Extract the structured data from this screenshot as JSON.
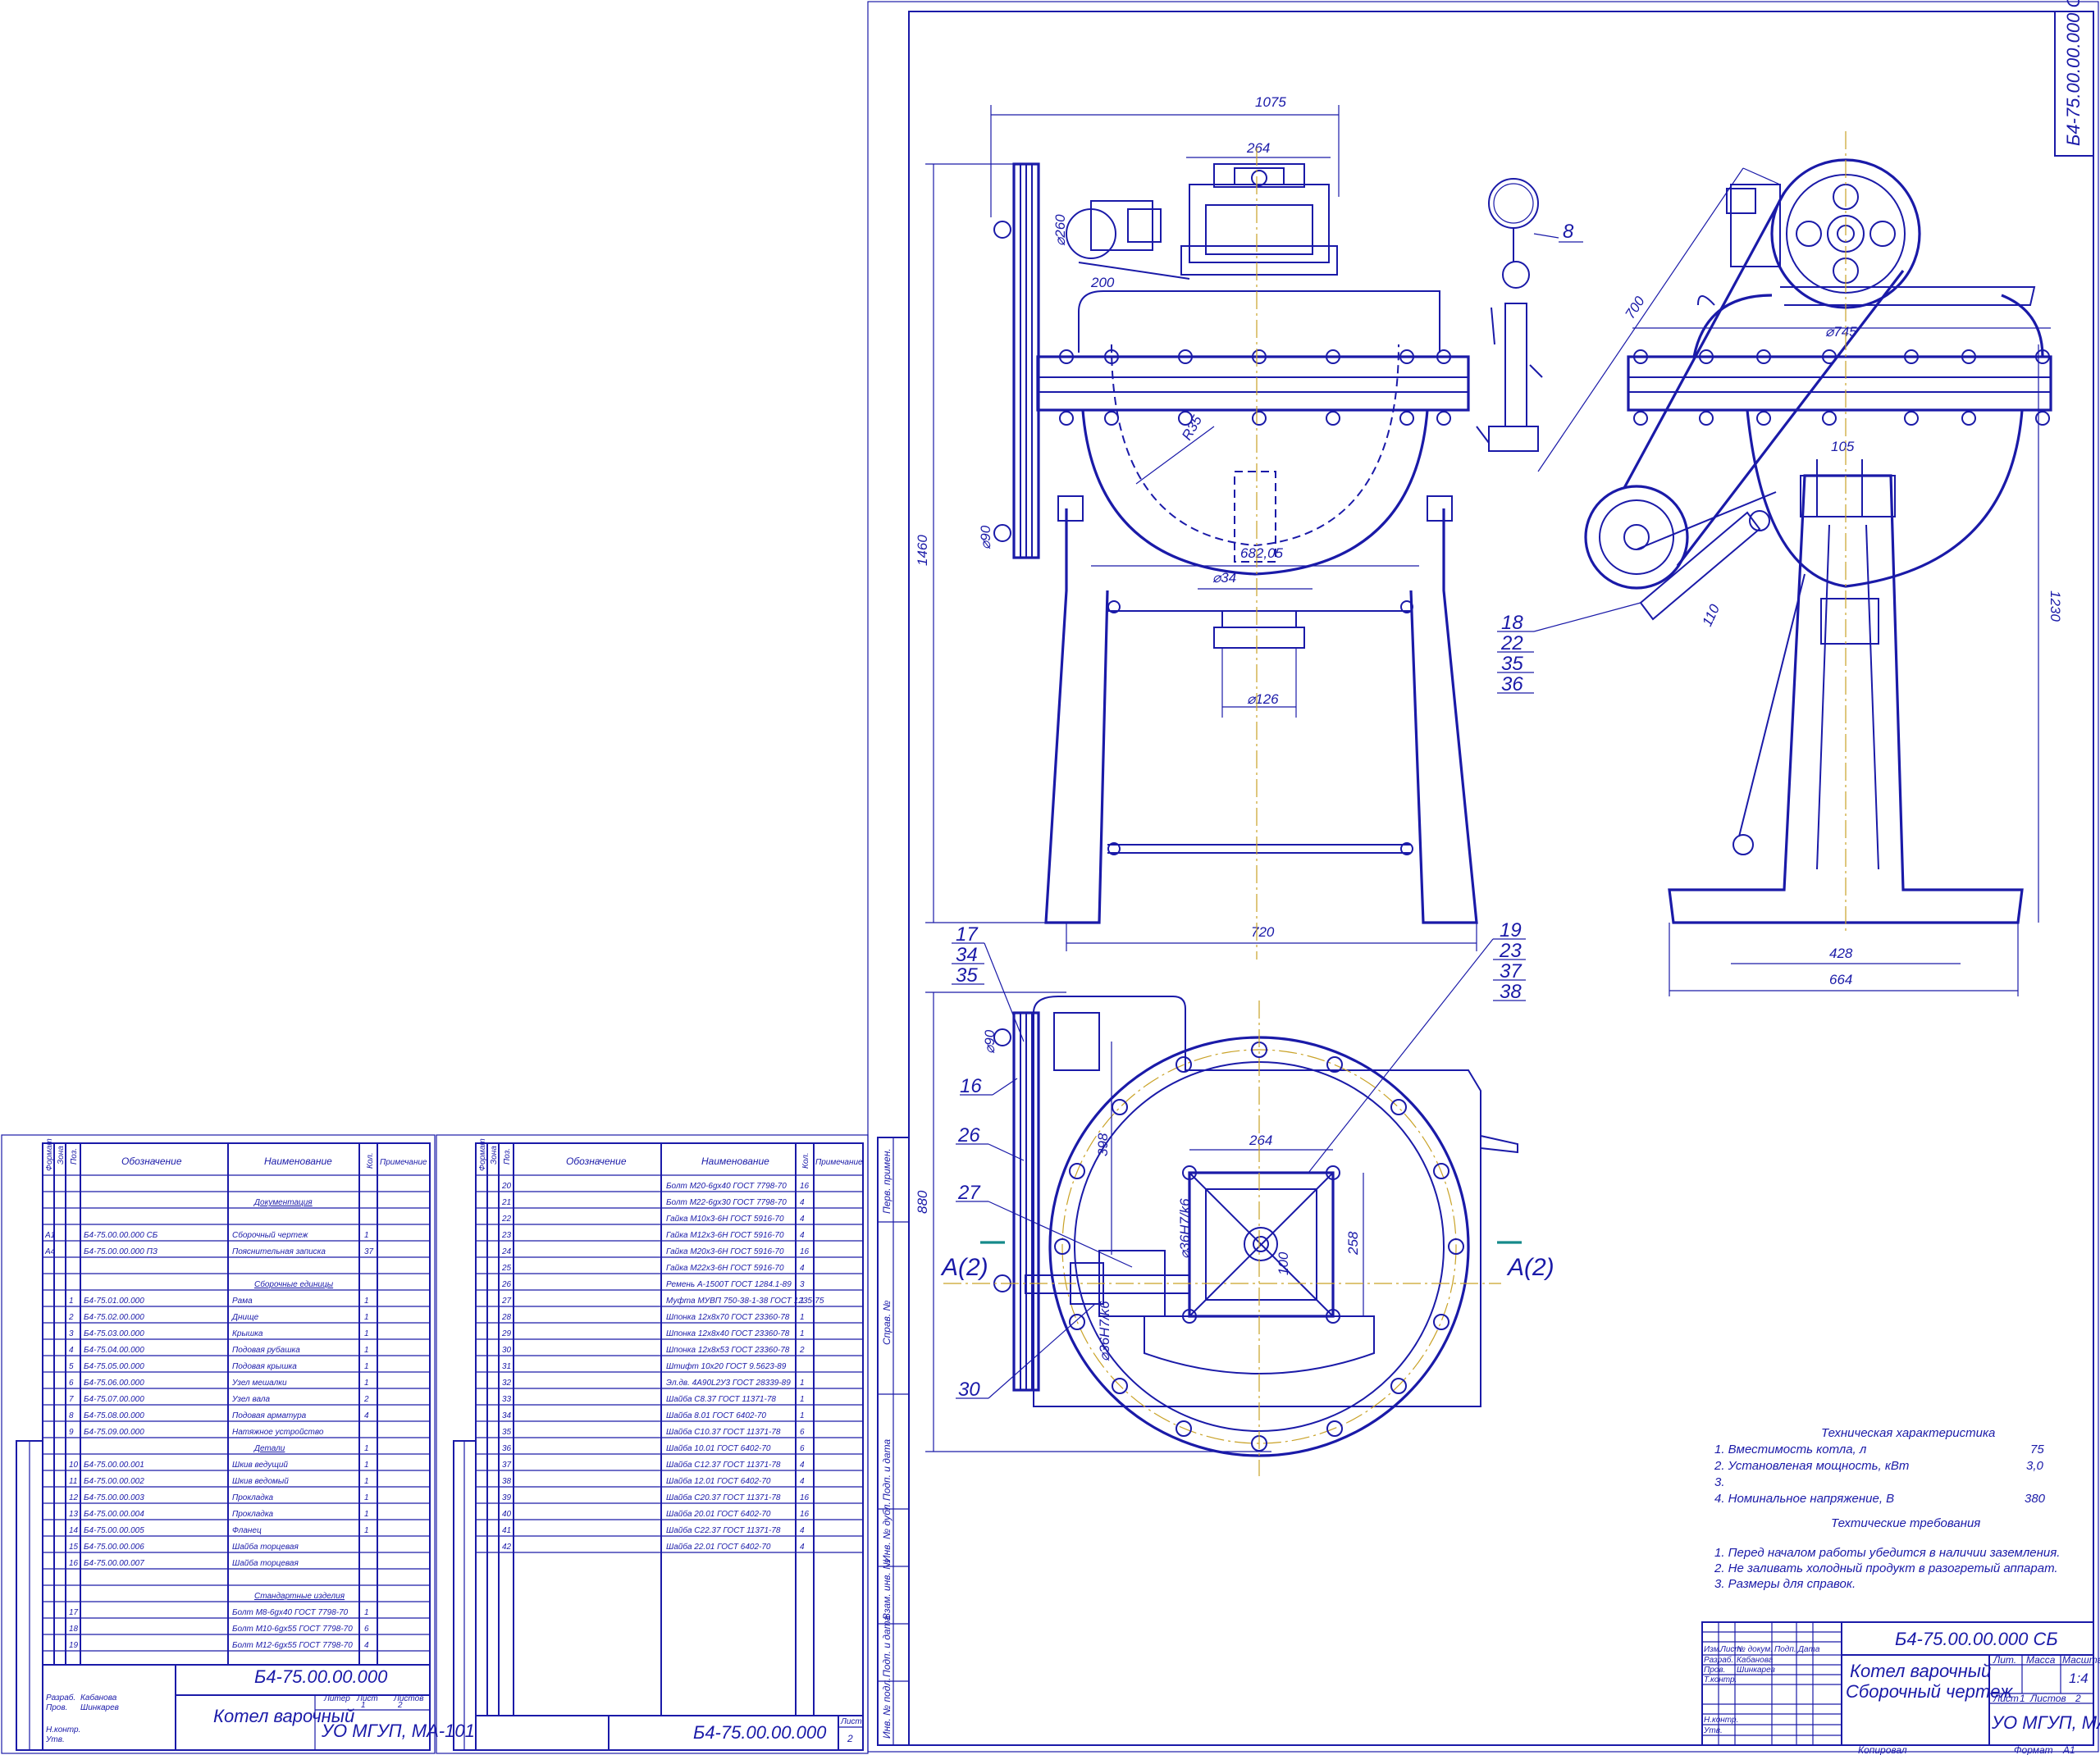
{
  "drawing": {
    "code": "Б4-75.00.00.000 СБ",
    "code_short": "Б4-75.00.00.000",
    "title_line1": "Котел варочный",
    "title_line2": "Сборочный чертеж",
    "org": "УО МГУП, МА-101",
    "mass_scale": "1:4",
    "sheet_label": "Лист",
    "sheet_value": "1",
    "sheets_label": "Листов",
    "sheets_value": "2",
    "lit_label": "Лит.",
    "mass_label": "Масса",
    "scale_label": "Масштаб",
    "copy_label": "Копировал",
    "format_label": "Формат",
    "format_value": "А1",
    "roles": [
      "Изм.",
      "Лист",
      "№ докум.",
      "Подп.",
      "Дата"
    ],
    "people": [
      {
        "role": "Разраб.",
        "name": "Кабанова"
      },
      {
        "role": "Пров.",
        "name": "Шинкарев"
      },
      {
        "role": "Т.контр.",
        "name": ""
      },
      {
        "role": "",
        "name": ""
      },
      {
        "role": "Н.контр.",
        "name": ""
      },
      {
        "role": "Утв.",
        "name": ""
      }
    ]
  },
  "side_stamp": [
    "Перв. примен.",
    "Справ. №",
    "Подп. и дата",
    "Инв. № дубл.",
    "Взам. инв. №",
    "Подп. и дата",
    "Инв. № подл."
  ],
  "dimensions": {
    "d1075": "1075",
    "d264a": "264",
    "d200": "200",
    "d260": "⌀260",
    "d1460": "1460",
    "d90a": "⌀90",
    "dR35": "R35",
    "d68205": "682,05",
    "d34": "⌀34",
    "d126": "⌀126",
    "d720": "720",
    "d700": "700",
    "d745": "⌀745",
    "d105": "105",
    "d110": "110",
    "d1230": "1230",
    "d428": "428",
    "d664": "664",
    "d90b": "⌀90",
    "d398": "398",
    "d264b": "264",
    "d258": "258",
    "d100": "100",
    "d880": "880",
    "fit1": "⌀36H7/k6",
    "fit2": "⌀36H7/k6"
  },
  "callouts": {
    "c8": "8",
    "c18": [
      "18",
      "22",
      "35",
      "36"
    ],
    "c17": [
      "17",
      "34",
      "35"
    ],
    "c19": [
      "19",
      "23",
      "37",
      "38"
    ],
    "c16": "16",
    "c26": "26",
    "c27": "27",
    "c30": "30"
  },
  "section": {
    "left": "А(2)",
    "right": "А(2)"
  },
  "tech": {
    "title": "Техническая характеристика",
    "rows": [
      {
        "text": "1. Вместимость котла, л",
        "value": "75"
      },
      {
        "text": "2. Установленая мощность, кВт",
        "value": "3,0"
      },
      {
        "text": "3.",
        "value": ""
      },
      {
        "text": "4. Номинальное напряжение, В",
        "value": "380"
      }
    ]
  },
  "req": {
    "title": "Техтические требования",
    "rows": [
      "1. Перед началом работы убедится в наличии заземления.",
      "2. Не заливать холодный продукт в разогретый аппарат.",
      "3. Размеры для справок."
    ]
  },
  "spec": {
    "headers": [
      "Формат",
      "Зона",
      "Поз.",
      "Обозначение",
      "Наименование",
      "Кол.",
      "Примечание"
    ],
    "sheet1": [
      {
        "fmt": "",
        "pos": "",
        "des": "",
        "name": "",
        "qty": ""
      },
      {
        "fmt": "",
        "pos": "",
        "des": "",
        "name": "Документация",
        "qty": "",
        "head": true
      },
      {
        "fmt": "",
        "pos": "",
        "des": "",
        "name": "",
        "qty": ""
      },
      {
        "fmt": "А1",
        "pos": "",
        "des": "Б4-75.00.00.000 СБ",
        "name": "Сборочный чертеж",
        "qty": "1"
      },
      {
        "fmt": "А4",
        "pos": "",
        "des": "Б4-75.00.00.000 ПЗ",
        "name": "Пояснительная записка",
        "qty": "37"
      },
      {
        "fmt": "",
        "pos": "",
        "des": "",
        "name": "",
        "qty": ""
      },
      {
        "fmt": "",
        "pos": "",
        "des": "",
        "name": "Сборочные единицы",
        "qty": "",
        "head": true
      },
      {
        "fmt": "",
        "pos": "1",
        "des": "Б4-75.01.00.000",
        "name": "Рама",
        "qty": "1"
      },
      {
        "fmt": "",
        "pos": "2",
        "des": "Б4-75.02.00.000",
        "name": "Днище",
        "qty": "1"
      },
      {
        "fmt": "",
        "pos": "3",
        "des": "Б4-75.03.00.000",
        "name": "Крышка",
        "qty": "1"
      },
      {
        "fmt": "",
        "pos": "4",
        "des": "Б4-75.04.00.000",
        "name": "Подовая рубашка",
        "qty": "1"
      },
      {
        "fmt": "",
        "pos": "5",
        "des": "Б4-75.05.00.000",
        "name": "Подовая крышка",
        "qty": "1"
      },
      {
        "fmt": "",
        "pos": "6",
        "des": "Б4-75.06.00.000",
        "name": "Узел мешалки",
        "qty": "1"
      },
      {
        "fmt": "",
        "pos": "7",
        "des": "Б4-75.07.00.000",
        "name": "Узел вала",
        "qty": "2"
      },
      {
        "fmt": "",
        "pos": "8",
        "des": "Б4-75.08.00.000",
        "name": "Подовая арматура",
        "qty": "4"
      },
      {
        "fmt": "",
        "pos": "9",
        "des": "Б4-75.09.00.000",
        "name": "Натяжное устройство",
        "qty": ""
      },
      {
        "fmt": "",
        "pos": "",
        "des": "",
        "name": "Детали",
        "qty": "1",
        "head": true
      },
      {
        "fmt": "",
        "pos": "10",
        "des": "Б4-75.00.00.001",
        "name": "Шкив ведущий",
        "qty": "1"
      },
      {
        "fmt": "",
        "pos": "11",
        "des": "Б4-75.00.00.002",
        "name": "Шкив ведомый",
        "qty": "1"
      },
      {
        "fmt": "",
        "pos": "12",
        "des": "Б4-75.00.00.003",
        "name": "Прокладка",
        "qty": "1"
      },
      {
        "fmt": "",
        "pos": "13",
        "des": "Б4-75.00.00.004",
        "name": "Прокладка",
        "qty": "1"
      },
      {
        "fmt": "",
        "pos": "14",
        "des": "Б4-75.00.00.005",
        "name": "Фланец",
        "qty": "1"
      },
      {
        "fmt": "",
        "pos": "15",
        "des": "Б4-75.00.00.006",
        "name": "Шайба торцевая",
        "qty": ""
      },
      {
        "fmt": "",
        "pos": "16",
        "des": "Б4-75.00.00.007",
        "name": "Шайба торцевая",
        "qty": ""
      },
      {
        "fmt": "",
        "pos": "",
        "des": "",
        "name": "",
        "qty": ""
      },
      {
        "fmt": "",
        "pos": "",
        "des": "",
        "name": "Стандартные изделия",
        "qty": "",
        "head": true
      },
      {
        "fmt": "",
        "pos": "17",
        "des": "",
        "name": "Болт М8-6gх40 ГОСТ 7798-70",
        "qty": "1"
      },
      {
        "fmt": "",
        "pos": "18",
        "des": "",
        "name": "Болт М10-6gх55 ГОСТ 7798-70",
        "qty": "6"
      },
      {
        "fmt": "",
        "pos": "19",
        "des": "",
        "name": "Болт М12-6gх55 ГОСТ 7798-70",
        "qty": "4"
      }
    ],
    "sheet2": [
      {
        "pos": "20",
        "name": "Болт М20-6gх40 ГОСТ 7798-70",
        "qty": "16"
      },
      {
        "pos": "21",
        "name": "Болт М22-6gх30 ГОСТ 7798-70",
        "qty": "4"
      },
      {
        "pos": "22",
        "name": "Гайка М10х3-6Н ГОСТ 5916-70",
        "qty": "4"
      },
      {
        "pos": "23",
        "name": "Гайка М12х3-6Н ГОСТ 5916-70",
        "qty": "4"
      },
      {
        "pos": "24",
        "name": "Гайка М20х3-6Н ГОСТ 5916-70",
        "qty": "16"
      },
      {
        "pos": "25",
        "name": "Гайка М22х3-6Н ГОСТ 5916-70",
        "qty": "4"
      },
      {
        "pos": "26",
        "name": "Ремень А-1500Т ГОСТ 1284.1-89",
        "qty": "3"
      },
      {
        "pos": "27",
        "name": "Муфта МУВП 750-38-1-38 ГОСТ 1235-75",
        "qty": "1"
      },
      {
        "pos": "28",
        "name": "Шпонка 12х8х70 ГОСТ 23360-78",
        "qty": "1"
      },
      {
        "pos": "29",
        "name": "Шпонка 12х8х40 ГОСТ 23360-78",
        "qty": "1"
      },
      {
        "pos": "30",
        "name": "Шпонка 12х8х53 ГОСТ 23360-78",
        "qty": "2"
      },
      {
        "pos": "31",
        "name": "Штифт 10х20 ГОСТ 9.5623-89",
        "qty": ""
      },
      {
        "pos": "32",
        "name": "Эл.дв. 4А90L2У3 ГОСТ 28339-89",
        "qty": "1"
      },
      {
        "pos": "33",
        "name": "Шайба С8.37 ГОСТ 11371-78",
        "qty": "1"
      },
      {
        "pos": "34",
        "name": "Шайба 8.01 ГОСТ 6402-70",
        "qty": "1"
      },
      {
        "pos": "35",
        "name": "Шайба С10.37 ГОСТ 11371-78",
        "qty": "6"
      },
      {
        "pos": "36",
        "name": "Шайба 10.01 ГОСТ 6402-70",
        "qty": "6"
      },
      {
        "pos": "37",
        "name": "Шайба С12.37 ГОСТ 11371-78",
        "qty": "4"
      },
      {
        "pos": "38",
        "name": "Шайба 12.01 ГОСТ 6402-70",
        "qty": "4"
      },
      {
        "pos": "39",
        "name": "Шайба С20.37 ГОСТ 11371-78",
        "qty": "16"
      },
      {
        "pos": "40",
        "name": "Шайба 20.01 ГОСТ 6402-70",
        "qty": "16"
      },
      {
        "pos": "41",
        "name": "Шайба С22.37 ГОСТ 11371-78",
        "qty": "4"
      },
      {
        "pos": "42",
        "name": "Шайба 22.01 ГОСТ 6402-70",
        "qty": "4"
      }
    ],
    "title": "Котел варочный",
    "code": "Б4-75.00.00.000",
    "org": "УО МГУП, МА-101",
    "people": [
      {
        "role": "Разраб.",
        "name": "Кабанова"
      },
      {
        "role": "Пров.",
        "name": "Шинкарев"
      },
      {
        "role": "Н.контр.",
        "name": ""
      },
      {
        "role": "Утв.",
        "name": ""
      }
    ],
    "sheet_label": "Лист",
    "sheet2_num": "2",
    "lit_label": "Литер",
    "sheets_label": "Листов",
    "sheet1_num": "1",
    "sheets_num": "2"
  }
}
